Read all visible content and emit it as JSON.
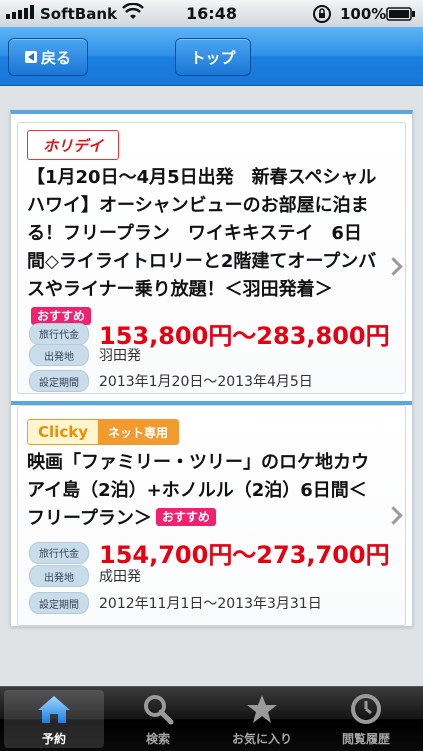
{
  "status": {
    "carrier": "SoftBank",
    "time": "16:48",
    "battery": "100%"
  },
  "nav": {
    "back_label": "戻る",
    "top_label": "トップ"
  },
  "tours": [
    {
      "logo": "ホリデイ",
      "title": "【1月20日～4月5日出発　新春スペシャルハワイ】オーシャンビューのお部屋に泊まる！フリープラン　ワイキキステイ　6日間◇ライライトロリーと2階建てオープンバスやライナー乗り放題！＜羽田発着＞",
      "badge": "おすすめ",
      "price_label": "旅行代金",
      "price": "153,800円～283,800円",
      "depart_label": "出発地",
      "depart": "羽田発",
      "period_label": "設定期間",
      "period": "2013年1月20日～2013年4月5日"
    },
    {
      "logo": "Clicky",
      "logo_sub": "ネット専用",
      "title": "映画「ファミリー・ツリー」のロケ地カウアイ島（2泊）+ホノルル（2泊）6日間＜フリープラン＞",
      "badge": "おすすめ",
      "price_label": "旅行代金",
      "price": "154,700円～273,700円",
      "depart_label": "出発地",
      "depart": "成田発",
      "period_label": "設定期間",
      "period": "2012年11月1日～2013年3月31日"
    }
  ],
  "tabbar": [
    {
      "label": "予約",
      "icon": "home-icon",
      "active": true
    },
    {
      "label": "検索",
      "icon": "search-icon",
      "active": false
    },
    {
      "label": "お気に入り",
      "icon": "star-icon",
      "active": false
    },
    {
      "label": "閲覧履歴",
      "icon": "clock-icon",
      "active": false
    }
  ],
  "colors": {
    "nav_blue": "#1a7fe0",
    "price_red": "#e60012",
    "badge_pink": "#f0216f"
  }
}
